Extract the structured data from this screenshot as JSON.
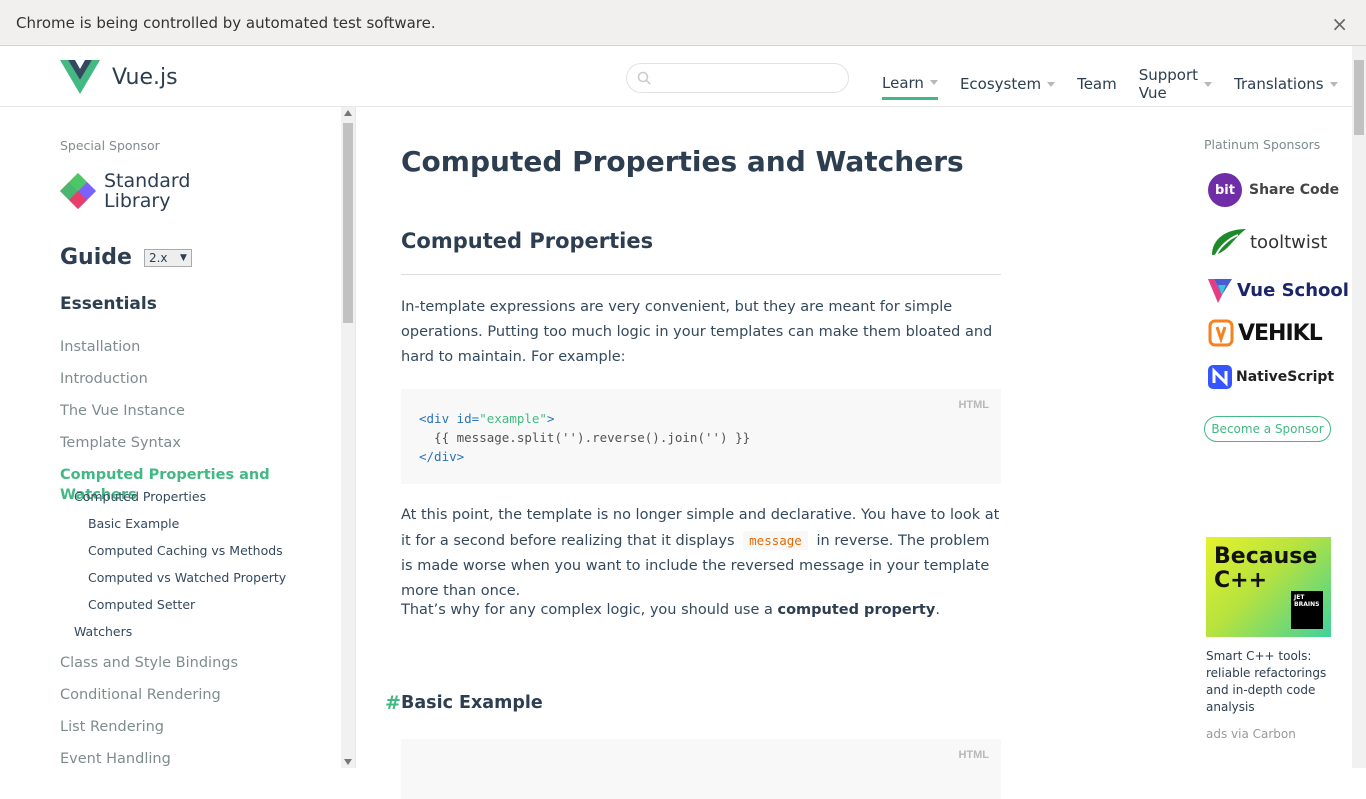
{
  "browser": {
    "infobar_text": "Chrome is being controlled by automated test software.",
    "close_symbol": "×"
  },
  "header": {
    "brand": "Vue.js",
    "search_placeholder": "",
    "nav": [
      {
        "label": "Learn",
        "dropdown": true,
        "active": true
      },
      {
        "label": "Ecosystem",
        "dropdown": true
      },
      {
        "label": "Team",
        "dropdown": false
      },
      {
        "label": "Support Vue",
        "dropdown": true
      },
      {
        "label": "Translations",
        "dropdown": true
      }
    ]
  },
  "sidebar": {
    "special_sponsor_label": "Special Sponsor",
    "special_sponsor_line1": "Standard",
    "special_sponsor_line2": "Library",
    "guide_title": "Guide",
    "version": "2.x",
    "section": "Essentials",
    "items": [
      "Installation",
      "Introduction",
      "The Vue Instance",
      "Template Syntax",
      "Computed Properties and Watchers"
    ],
    "subitems": {
      "computed_properties": "Computed Properties",
      "basic_example": "Basic Example",
      "caching": "Computed Caching vs Methods",
      "vs_watched": "Computed vs Watched Property",
      "setter": "Computed Setter",
      "watchers": "Watchers"
    },
    "items_after": [
      "Class and Style Bindings",
      "Conditional Rendering",
      "List Rendering",
      "Event Handling"
    ]
  },
  "content": {
    "title": "Computed Properties and Watchers",
    "section_title": "Computed Properties",
    "p1": "In-template expressions are very convenient, but they are meant for simple operations. Putting too much logic in your templates can make them bloated and hard to maintain. For example:",
    "code_lang": "HTML",
    "code1_line1_tag_open": "<div",
    "code1_line1_attr": " id=",
    "code1_line1_str": "\"example\"",
    "code1_line1_close": ">",
    "code1_line2": "  {{ message.split('').reverse().join('') }}",
    "code1_line3": "</div>",
    "p2_part1": "At this point, the template is no longer simple and declarative. You have to look at it for a second before realizing that it displays",
    "p2_code": "message",
    "p2_part2": "in reverse. The problem is made worse when you want to include the reversed message in your template more than once.",
    "p3_part1": "That’s why for any complex logic, you should use a ",
    "p3_bold": "computed property",
    "p3_part2": ".",
    "hash": "#",
    "basic_example": "Basic Example",
    "code2_lang": "HTML"
  },
  "right": {
    "platinum_label": "Platinum Sponsors",
    "sponsors": [
      "Share Code",
      "tooltwist",
      "Vue School",
      "VEHIKL",
      "NativeScript"
    ],
    "bit_badge": "bit",
    "become_sponsor": "Become a Sponsor",
    "ad_headline_1": "Because",
    "ad_headline_2": "C++",
    "ad_badge_1": "JET",
    "ad_badge_2": "BRAINS",
    "ad_text": "Smart C++ tools: reliable refactorings and in-depth code analysis",
    "ads_via": "ads via Carbon"
  },
  "colors": {
    "accent": "#42b983",
    "text": "#2c3e50",
    "muted": "#7f8c8d"
  }
}
